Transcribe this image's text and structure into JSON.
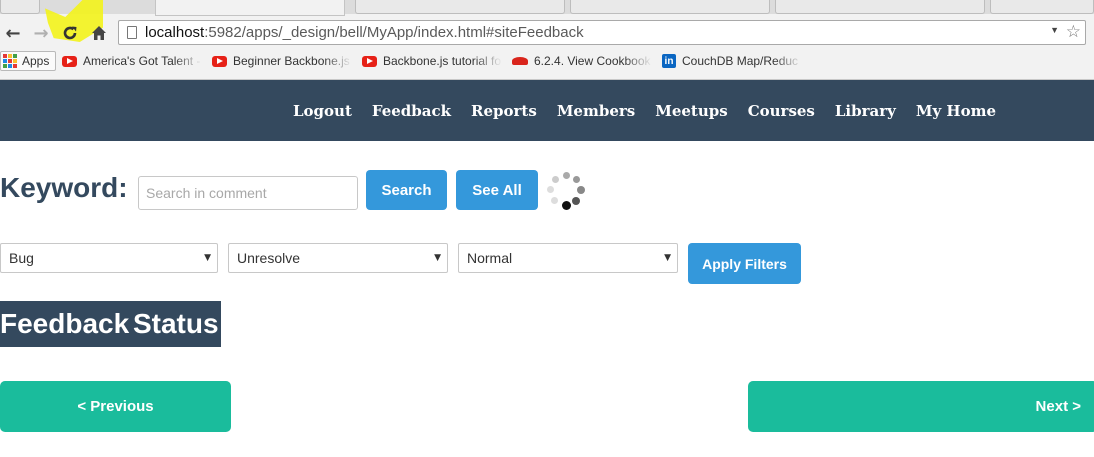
{
  "browser": {
    "url_host": "localhost",
    "url_rest": ":5982/apps/_design/bell/MyApp/index.html#siteFeedback",
    "bookmarks": [
      {
        "label": "Apps",
        "icon": "apps-grid-icon"
      },
      {
        "label": "America's Got Talent -",
        "icon": "youtube-icon"
      },
      {
        "label": "Beginner Backbone.js",
        "icon": "youtube-icon"
      },
      {
        "label": "Backbone.js tutorial fo",
        "icon": "youtube-icon"
      },
      {
        "label": "6.2.4. View Cookbook",
        "icon": "couchdb-icon"
      },
      {
        "label": "CouchDB Map/Reduc",
        "icon": "linkedin-icon"
      }
    ]
  },
  "nav": {
    "links": [
      "Logout",
      "Feedback",
      "Reports",
      "Members",
      "Meetups",
      "Courses",
      "Library",
      "My Home"
    ],
    "background": "#34495e"
  },
  "search": {
    "label": "Keyword:",
    "placeholder": "Search in comment",
    "search_button": "Search",
    "see_all_button": "See All"
  },
  "filters": {
    "category": "Bug",
    "status": "Unresolve",
    "priority": "Normal",
    "apply_button": "Apply Filters"
  },
  "heading": "Feedback Status",
  "pager": {
    "previous": "< Previous",
    "next": "Next >"
  },
  "colors": {
    "primary_blue": "#3498db",
    "accent_green": "#1abc9c",
    "dark_navy": "#34495e"
  }
}
